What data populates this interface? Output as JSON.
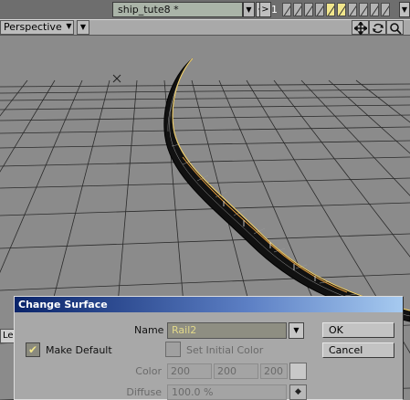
{
  "toolbar": {
    "object_name": "ship_tute8 *",
    "prev_label": "<",
    "next_label": ">",
    "layer_number": "1",
    "dropdown_arrow": "▼"
  },
  "viewport": {
    "view_mode": "Perspective",
    "dropdown_arrow": "▼",
    "tools": [
      "move-icon",
      "rotate-icon",
      "zoom-icon"
    ]
  },
  "side_tab_label": "Le",
  "dialog": {
    "title": "Change Surface",
    "name_label": "Name",
    "name_value": "Rail2",
    "ok_label": "OK",
    "cancel_label": "Cancel",
    "make_default_label": "Make Default",
    "make_default_checked": "✔",
    "set_initial_color_label": "Set Initial Color",
    "color_label": "Color",
    "color_r": "200",
    "color_g": "200",
    "color_b": "200",
    "diffuse_label": "Diffuse",
    "diffuse_value": "100.0 %",
    "envelope_icon": "◆"
  },
  "colors": {
    "accent_yellow": "#f1e68c",
    "title_bar": "#0a246a",
    "grid_bg": "#8a8a8a"
  }
}
